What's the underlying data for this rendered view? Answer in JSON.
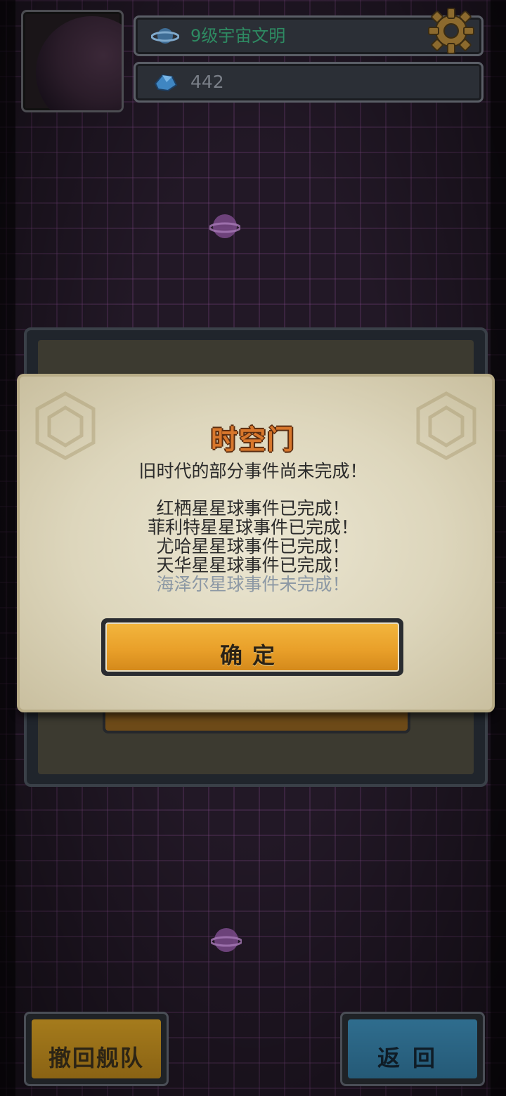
{
  "hud": {
    "level_text": "9级宇宙文明",
    "gems_count": "442",
    "icons": {
      "level": "planet-ring-icon",
      "gems": "blue-crystal-icon",
      "settings": "gear-icon",
      "avatar": "planet-avatar"
    }
  },
  "dialog": {
    "title": "时空门",
    "subtitle": "旧时代的部分事件尚未完成！",
    "events": [
      {
        "text": "红栖星星球事件已完成！",
        "done": true
      },
      {
        "text": "菲利特星星球事件已完成！",
        "done": true
      },
      {
        "text": "尤哈星星球事件已完成！",
        "done": true
      },
      {
        "text": "天华星星球事件已完成！",
        "done": true
      },
      {
        "text": "海泽尔星球事件未完成！",
        "done": false
      }
    ],
    "confirm_label": "确定"
  },
  "bottom": {
    "recall_label": "撤回舰队",
    "return_label": "返回"
  },
  "colors": {
    "title_orange": "#d8772c",
    "level_green": "#2e8a62",
    "pending_gray": "#8c98a4",
    "confirm_gold": "#e9a02a",
    "return_blue": "#2f6d8e",
    "recall_gold": "#a57b1c"
  }
}
